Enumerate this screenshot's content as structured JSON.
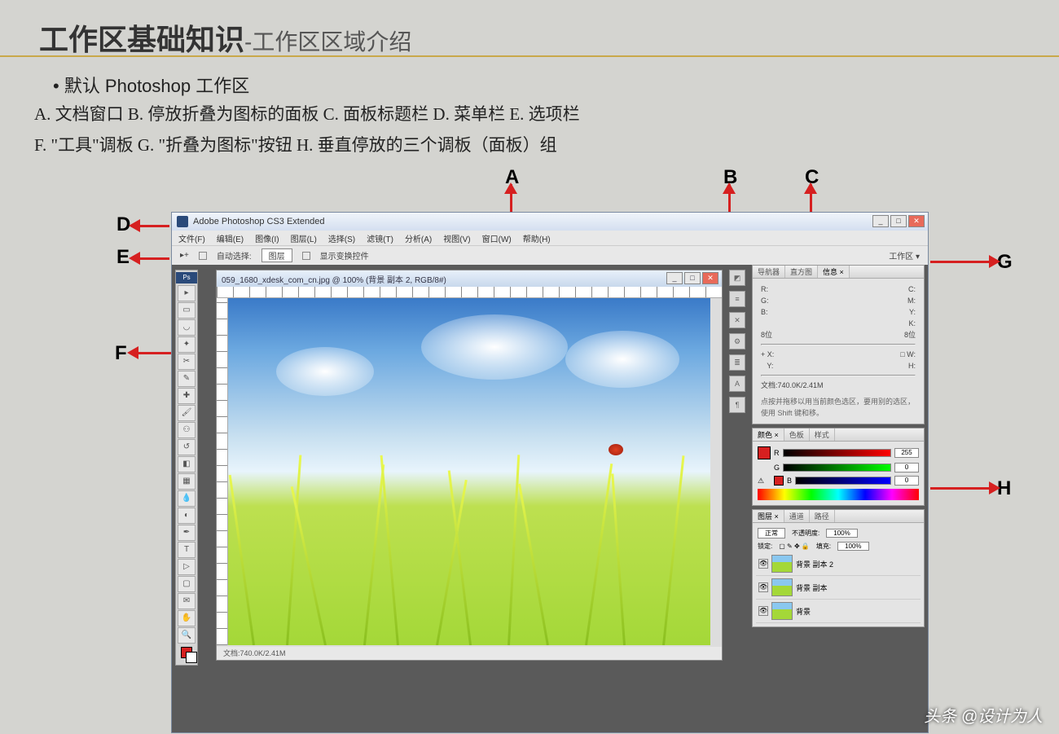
{
  "slide": {
    "title_main": "工作区基础知识",
    "title_sub": "-工作区区域介绍",
    "bullet": "•  默认 Photoshop 工作区",
    "legend_row1": "A. 文档窗口   B. 停放折叠为图标的面板   C. 面板标题栏   D. 菜单栏   E. 选项栏",
    "legend_row2": "F. \"工具\"调板   G. \"折叠为图标\"按钮   H. 垂直停放的三个调板（面板）组"
  },
  "labels": {
    "A": "A",
    "B": "B",
    "C": "C",
    "D": "D",
    "E": "E",
    "F": "F",
    "G": "G",
    "H": "H"
  },
  "ps": {
    "app_title": "Adobe Photoshop CS3 Extended",
    "menus": [
      "文件(F)",
      "编辑(E)",
      "图像(I)",
      "图层(L)",
      "选择(S)",
      "滤镜(T)",
      "分析(A)",
      "视图(V)",
      "窗口(W)",
      "帮助(H)"
    ],
    "options": {
      "auto": "自动选择:",
      "layer": "图层",
      "show": "显示变换控件",
      "workspace": "工作区 ▾"
    },
    "doc_title": "059_1680_xdesk_com_cn.jpg @ 100% (背景 副本 2, RGB/8#)",
    "doc_status": "文档:740.0K/2.41M",
    "info_panel": {
      "tabs": [
        "导航器",
        "直方图",
        "信息 ×"
      ],
      "r": "R:",
      "c": "C:",
      "g": "G:",
      "m": "M:",
      "b": "B:",
      "y": "Y:",
      "k": "K:",
      "deg": "8位",
      "deg2": "8位",
      "x": "X:",
      "w": "W:",
      "y2": "Y:",
      "h": "H:",
      "doc": "文档:740.0K/2.41M",
      "hint": "点按并拖移以用当前颜色选区，要用别的选区，使用 Shift 键和移。"
    },
    "color_panel": {
      "tabs": [
        "颜色 ×",
        "色板",
        "样式"
      ],
      "r": "R",
      "g": "G",
      "b": "B",
      "val_r": "255",
      "val_g": "0",
      "val_b": "0"
    },
    "layers_panel": {
      "tabs": [
        "图层 ×",
        "通道",
        "路径"
      ],
      "mode": "正常",
      "opacity_lbl": "不透明度:",
      "opacity": "100%",
      "lock": "锁定:",
      "fill_lbl": "填充:",
      "fill": "100%",
      "layers": [
        "背景 副本 2",
        "背景 副本",
        "背景"
      ]
    }
  },
  "watermark": "头条 @设计为人"
}
